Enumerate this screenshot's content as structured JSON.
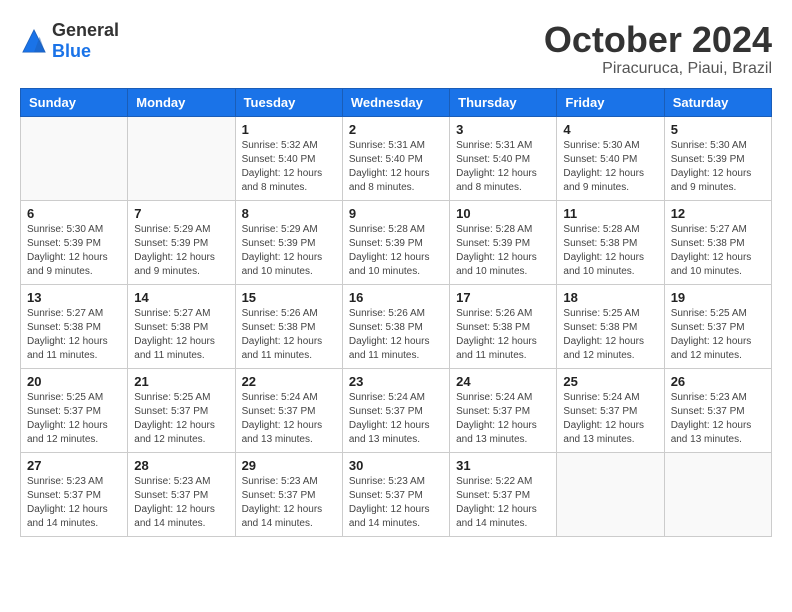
{
  "logo": {
    "general": "General",
    "blue": "Blue"
  },
  "title": {
    "month": "October 2024",
    "location": "Piracuruca, Piaui, Brazil"
  },
  "headers": [
    "Sunday",
    "Monday",
    "Tuesday",
    "Wednesday",
    "Thursday",
    "Friday",
    "Saturday"
  ],
  "weeks": [
    [
      {
        "day": "",
        "info": ""
      },
      {
        "day": "",
        "info": ""
      },
      {
        "day": "1",
        "info": "Sunrise: 5:32 AM\nSunset: 5:40 PM\nDaylight: 12 hours and 8 minutes."
      },
      {
        "day": "2",
        "info": "Sunrise: 5:31 AM\nSunset: 5:40 PM\nDaylight: 12 hours and 8 minutes."
      },
      {
        "day": "3",
        "info": "Sunrise: 5:31 AM\nSunset: 5:40 PM\nDaylight: 12 hours and 8 minutes."
      },
      {
        "day": "4",
        "info": "Sunrise: 5:30 AM\nSunset: 5:40 PM\nDaylight: 12 hours and 9 minutes."
      },
      {
        "day": "5",
        "info": "Sunrise: 5:30 AM\nSunset: 5:39 PM\nDaylight: 12 hours and 9 minutes."
      }
    ],
    [
      {
        "day": "6",
        "info": "Sunrise: 5:30 AM\nSunset: 5:39 PM\nDaylight: 12 hours and 9 minutes."
      },
      {
        "day": "7",
        "info": "Sunrise: 5:29 AM\nSunset: 5:39 PM\nDaylight: 12 hours and 9 minutes."
      },
      {
        "day": "8",
        "info": "Sunrise: 5:29 AM\nSunset: 5:39 PM\nDaylight: 12 hours and 10 minutes."
      },
      {
        "day": "9",
        "info": "Sunrise: 5:28 AM\nSunset: 5:39 PM\nDaylight: 12 hours and 10 minutes."
      },
      {
        "day": "10",
        "info": "Sunrise: 5:28 AM\nSunset: 5:39 PM\nDaylight: 12 hours and 10 minutes."
      },
      {
        "day": "11",
        "info": "Sunrise: 5:28 AM\nSunset: 5:38 PM\nDaylight: 12 hours and 10 minutes."
      },
      {
        "day": "12",
        "info": "Sunrise: 5:27 AM\nSunset: 5:38 PM\nDaylight: 12 hours and 10 minutes."
      }
    ],
    [
      {
        "day": "13",
        "info": "Sunrise: 5:27 AM\nSunset: 5:38 PM\nDaylight: 12 hours and 11 minutes."
      },
      {
        "day": "14",
        "info": "Sunrise: 5:27 AM\nSunset: 5:38 PM\nDaylight: 12 hours and 11 minutes."
      },
      {
        "day": "15",
        "info": "Sunrise: 5:26 AM\nSunset: 5:38 PM\nDaylight: 12 hours and 11 minutes."
      },
      {
        "day": "16",
        "info": "Sunrise: 5:26 AM\nSunset: 5:38 PM\nDaylight: 12 hours and 11 minutes."
      },
      {
        "day": "17",
        "info": "Sunrise: 5:26 AM\nSunset: 5:38 PM\nDaylight: 12 hours and 11 minutes."
      },
      {
        "day": "18",
        "info": "Sunrise: 5:25 AM\nSunset: 5:38 PM\nDaylight: 12 hours and 12 minutes."
      },
      {
        "day": "19",
        "info": "Sunrise: 5:25 AM\nSunset: 5:37 PM\nDaylight: 12 hours and 12 minutes."
      }
    ],
    [
      {
        "day": "20",
        "info": "Sunrise: 5:25 AM\nSunset: 5:37 PM\nDaylight: 12 hours and 12 minutes."
      },
      {
        "day": "21",
        "info": "Sunrise: 5:25 AM\nSunset: 5:37 PM\nDaylight: 12 hours and 12 minutes."
      },
      {
        "day": "22",
        "info": "Sunrise: 5:24 AM\nSunset: 5:37 PM\nDaylight: 12 hours and 13 minutes."
      },
      {
        "day": "23",
        "info": "Sunrise: 5:24 AM\nSunset: 5:37 PM\nDaylight: 12 hours and 13 minutes."
      },
      {
        "day": "24",
        "info": "Sunrise: 5:24 AM\nSunset: 5:37 PM\nDaylight: 12 hours and 13 minutes."
      },
      {
        "day": "25",
        "info": "Sunrise: 5:24 AM\nSunset: 5:37 PM\nDaylight: 12 hours and 13 minutes."
      },
      {
        "day": "26",
        "info": "Sunrise: 5:23 AM\nSunset: 5:37 PM\nDaylight: 12 hours and 13 minutes."
      }
    ],
    [
      {
        "day": "27",
        "info": "Sunrise: 5:23 AM\nSunset: 5:37 PM\nDaylight: 12 hours and 14 minutes."
      },
      {
        "day": "28",
        "info": "Sunrise: 5:23 AM\nSunset: 5:37 PM\nDaylight: 12 hours and 14 minutes."
      },
      {
        "day": "29",
        "info": "Sunrise: 5:23 AM\nSunset: 5:37 PM\nDaylight: 12 hours and 14 minutes."
      },
      {
        "day": "30",
        "info": "Sunrise: 5:23 AM\nSunset: 5:37 PM\nDaylight: 12 hours and 14 minutes."
      },
      {
        "day": "31",
        "info": "Sunrise: 5:22 AM\nSunset: 5:37 PM\nDaylight: 12 hours and 14 minutes."
      },
      {
        "day": "",
        "info": ""
      },
      {
        "day": "",
        "info": ""
      }
    ]
  ]
}
